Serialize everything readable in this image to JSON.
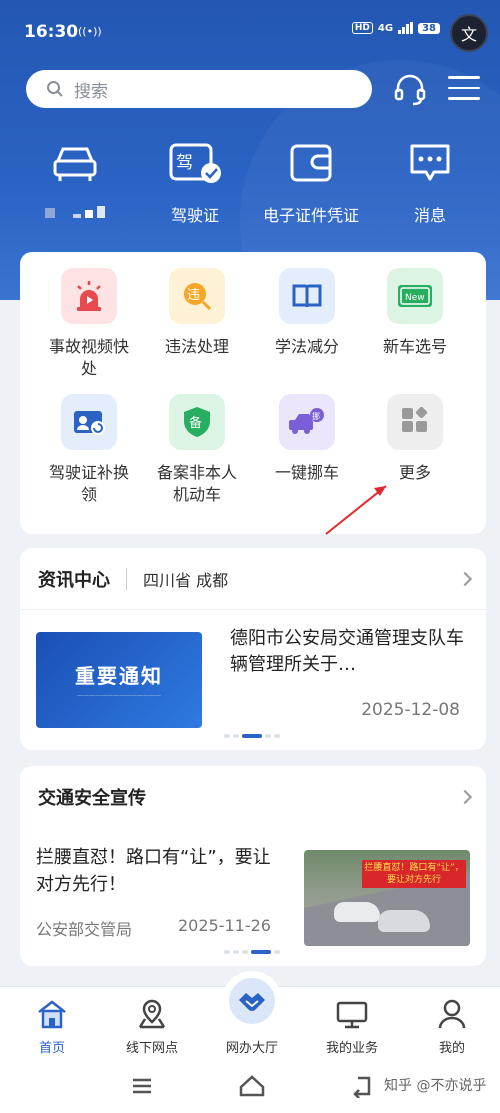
{
  "status": {
    "time": "16:30",
    "network": "4G",
    "hd": "HD",
    "battery": "38",
    "lang_label": "文"
  },
  "search": {
    "placeholder": "搜索"
  },
  "quick_actions": [
    {
      "label": "",
      "icon": "car-icon"
    },
    {
      "label": "驾驶证",
      "icon": "license-icon"
    },
    {
      "label": "电子证件凭证",
      "icon": "wallet-icon"
    },
    {
      "label": "消息",
      "icon": "message-icon"
    }
  ],
  "services": [
    {
      "label": "事故视频快处",
      "icon": "alarm-video-icon",
      "bg": "#fde3e3"
    },
    {
      "label": "违法处理",
      "icon": "violation-icon",
      "bg": "#fff1d6"
    },
    {
      "label": "学法减分",
      "icon": "book-icon",
      "bg": "#e3edfc"
    },
    {
      "label": "新车选号",
      "icon": "new-plate-icon",
      "bg": "#dcf4e4"
    },
    {
      "label": "驾驶证补换领",
      "icon": "license-renew-icon",
      "bg": "#e3edfc"
    },
    {
      "label": "备案非本人机动车",
      "icon": "record-shield-icon",
      "bg": "#dcf4e4"
    },
    {
      "label": "一键挪车",
      "icon": "move-car-icon",
      "bg": "#ebe6fb"
    },
    {
      "label": "更多",
      "icon": "more-grid-icon",
      "bg": "#eeeeee"
    }
  ],
  "news_card": {
    "title": "资讯中心",
    "region": "四川省 成都",
    "thumb_text": "重要通知",
    "item_title": "德阳市公安局交通管理支队车辆管理所关于…",
    "date": "2025-12-08"
  },
  "promo_card": {
    "title": "交通安全宣传",
    "item_title": "拦腰直怼！路口有“让”，要让对方先行！",
    "source": "公安部交管局",
    "date": "2025-11-26",
    "image_banner": "拦腰直怼！路口有“让”，要让对方先行"
  },
  "tabs": [
    {
      "label": "首页",
      "icon": "home-icon",
      "active": true
    },
    {
      "label": "线下网点",
      "icon": "map-pin-icon",
      "active": false
    },
    {
      "label": "网办大厅",
      "icon": "handshake-icon",
      "active": false
    },
    {
      "label": "我的业务",
      "icon": "monitor-icon",
      "active": false
    },
    {
      "label": "我的",
      "icon": "user-icon",
      "active": false
    }
  ],
  "watermark": "知乎 @不亦说乎",
  "colors": {
    "brand": "#2a63c4",
    "hero": "#2457b3",
    "annotation_arrow": "#e0292e"
  }
}
